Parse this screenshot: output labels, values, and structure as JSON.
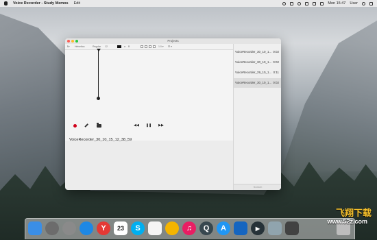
{
  "menubar": {
    "app_name": "Voice Recorder - Study Memos",
    "menu_edit": "Edit",
    "clock": "Mon 15:47",
    "user": "User"
  },
  "window": {
    "title": "Projects",
    "toolbar": {
      "font": "Helvetica",
      "style": "Regular",
      "size": "12"
    },
    "playback": {
      "rewind": "◀◀",
      "pause": "❚❚",
      "forward": "▶▶"
    },
    "current_file": "VoiceRecorder_30_10_15_12_38_59",
    "files": [
      {
        "name": "VoiceRecorder_30_10_1...",
        "duration": "0:02",
        "selected": false
      },
      {
        "name": "VoiceRecorder_30_10_1...",
        "duration": "0:02",
        "selected": false
      },
      {
        "name": "VoiceRecorder_29_10_1...",
        "duration": "0:11",
        "selected": false
      },
      {
        "name": "VoiceRecorder_30_10_1...",
        "duration": "0:02",
        "selected": true
      }
    ],
    "search_placeholder": "Search"
  },
  "dock": {
    "items": [
      {
        "icon": "finder-icon",
        "label": "",
        "bg": "#3a8ee6"
      },
      {
        "icon": "launchpad-icon",
        "label": "",
        "bg": "#6c6c6c"
      },
      {
        "icon": "system-preferences-icon",
        "label": "",
        "bg": "#8a8a8a"
      },
      {
        "icon": "safari-icon",
        "label": "",
        "bg": "#1e88e5"
      },
      {
        "icon": "yandex-icon",
        "label": "Y",
        "bg": "#e53935"
      },
      {
        "icon": "calendar-icon",
        "label": "23",
        "bg": "#ffffff"
      },
      {
        "icon": "skype-icon",
        "label": "S",
        "bg": "#00aff0"
      },
      {
        "icon": "notes-icon",
        "label": "",
        "bg": "#f5f5f5"
      },
      {
        "icon": "photos-icon",
        "label": "",
        "bg": "#f4b400"
      },
      {
        "icon": "itunes-icon",
        "label": "♫",
        "bg": "#e91e63"
      },
      {
        "icon": "quicktime-icon",
        "label": "Q",
        "bg": "#37474f"
      },
      {
        "icon": "app-store-icon",
        "label": "A",
        "bg": "#2196f3"
      },
      {
        "icon": "xcode-icon",
        "label": "",
        "bg": "#1565c0"
      },
      {
        "icon": "quicktime-player-icon",
        "label": "▶",
        "bg": "#263238"
      },
      {
        "icon": "preview-icon",
        "label": "",
        "bg": "#90a4ae"
      },
      {
        "icon": "terminal-icon",
        "label": "",
        "bg": "#424242"
      },
      {
        "icon": "trash-icon",
        "label": "",
        "bg": "#bdbdbd"
      }
    ]
  },
  "watermark": {
    "line1": "飞翔下载",
    "line2": "www.52z.com"
  }
}
